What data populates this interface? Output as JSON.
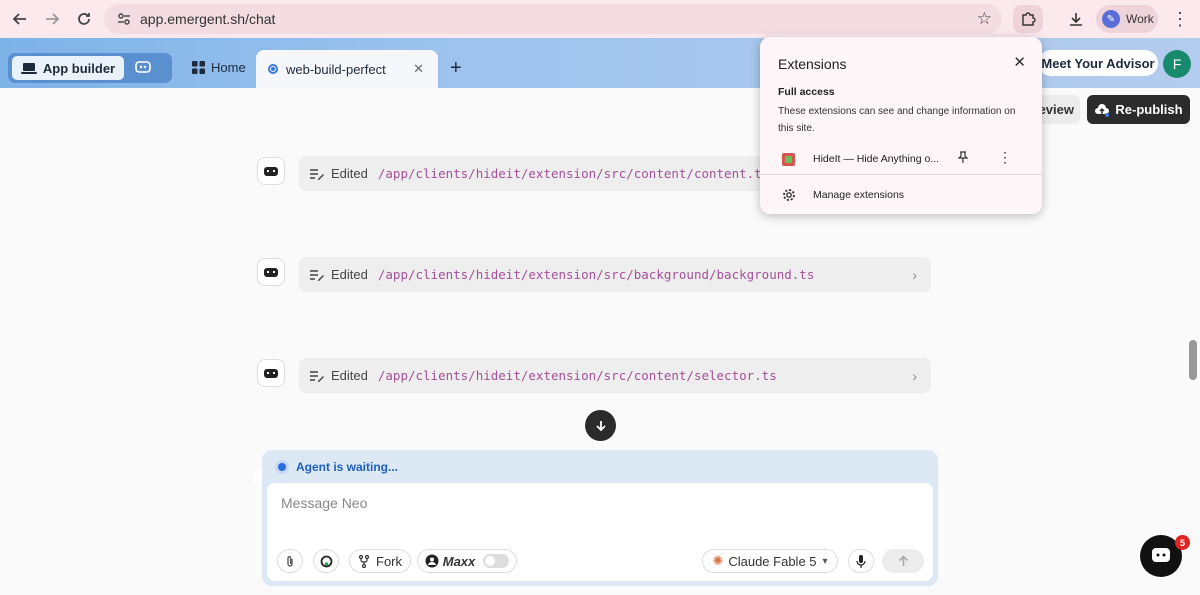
{
  "browser": {
    "url": "app.emergent.sh/chat",
    "profile_label": "Work",
    "back_icon": "arrow-left-icon",
    "forward_icon": "arrow-right-icon",
    "reload_icon": "reload-icon",
    "bookmark_icon": "star-icon",
    "extensions_icon": "puzzle-icon",
    "download_icon": "download-icon",
    "menu_icon": "kebab-icon"
  },
  "header": {
    "app_builder_label": "App builder",
    "home_label": "Home",
    "active_tab_label": "web-build-perfect",
    "tab_close": "✕",
    "new_tab": "+",
    "advisor_label": "Meet Your Advisor",
    "avatar_letter": "F"
  },
  "actions": {
    "preview_label": "eview",
    "republish_label": "Re-publish"
  },
  "messages": [
    {
      "label": "Edited",
      "path": "/app/clients/hideit/extension/src/content/content.ts"
    },
    {
      "label": "Edited",
      "path": "/app/clients/hideit/extension/src/background/background.ts"
    },
    {
      "label": "Edited",
      "path": "/app/clients/hideit/extension/src/content/selector.ts"
    }
  ],
  "composer": {
    "status": "Agent is waiting...",
    "placeholder": "Message Neo",
    "fork_label": "Fork",
    "maxx_label": "Maxx",
    "model_label": "Claude Fable 5"
  },
  "extensions_popup": {
    "title": "Extensions",
    "section": "Full access",
    "description": "These extensions can see and change information on this site.",
    "extension_name": "HideIt — Hide Anything o...",
    "manage_label": "Manage extensions"
  },
  "support": {
    "badge_count": "5"
  },
  "colors": {
    "accent_blue": "#3a7be0",
    "path_purple": "#a4509a",
    "dark_button": "#2b2b2b"
  }
}
